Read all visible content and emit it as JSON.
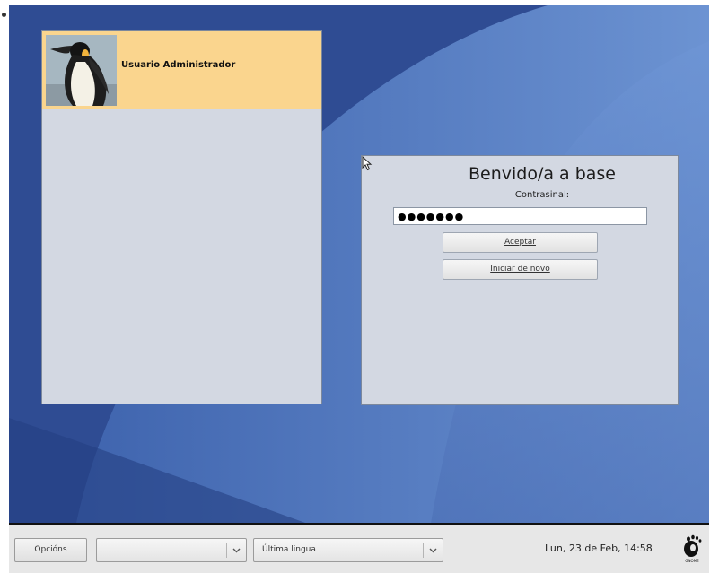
{
  "user_list": {
    "users": [
      {
        "name": "Usuario Administrador",
        "avatar": "penguin-avatar"
      }
    ]
  },
  "login": {
    "title": "Benvido/a a base",
    "password_label": "Contrasinal:",
    "password_mask": "●●●●●●●",
    "accept_label": "Aceptar",
    "restart_label": "Iniciar de novo"
  },
  "taskbar": {
    "options_label": "Opcións",
    "session_value": "",
    "language_value": "Última lingua",
    "datetime": "Lun, 23 de Feb, 14:58",
    "logo_caption": "GNOME",
    "icons": {
      "dropdown": "chevron-down-icon",
      "cursor": "mouse-pointer-icon",
      "logo": "gnome-foot-icon"
    }
  },
  "colors": {
    "desktop_bg": "#2f4c93",
    "selected_user_bg": "#fad58e",
    "panel_bg": "#d3d8e2",
    "taskbar_bg": "#e7e7e7"
  }
}
